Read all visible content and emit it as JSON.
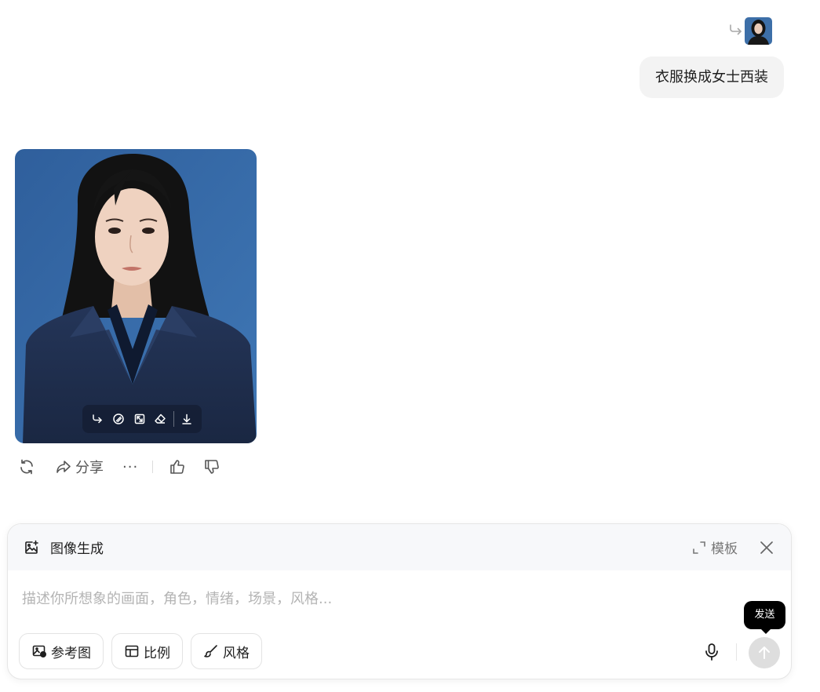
{
  "user_message": {
    "text": "衣服换成女士西装",
    "reference_icon": "reply-arrow-icon",
    "attachment": "reference-thumbnail"
  },
  "generated_image": {
    "toolbar": [
      {
        "name": "reply-reference-icon"
      },
      {
        "name": "edit-brush-icon"
      },
      {
        "name": "expand-crop-icon"
      },
      {
        "name": "eraser-icon"
      },
      {
        "name": "download-icon"
      }
    ]
  },
  "actions": {
    "regenerate_icon": "refresh-icon",
    "share_label": "分享",
    "more_label": "···",
    "like_icon": "thumbs-up-icon",
    "dislike_icon": "thumbs-down-icon"
  },
  "composer": {
    "mode_label": "图像生成",
    "template_label": "模板",
    "input_value": "",
    "placeholder": "描述你所想象的画面，角色，情绪，场景，风格...",
    "chips": {
      "reference": "参考图",
      "ratio": "比例",
      "style": "风格"
    },
    "send_tooltip": "发送"
  },
  "colors": {
    "bubble_bg": "#f3f3f3",
    "composer_header_bg": "#f7f8fa",
    "send_disabled": "#dedede",
    "tooltip_bg": "#000000"
  }
}
